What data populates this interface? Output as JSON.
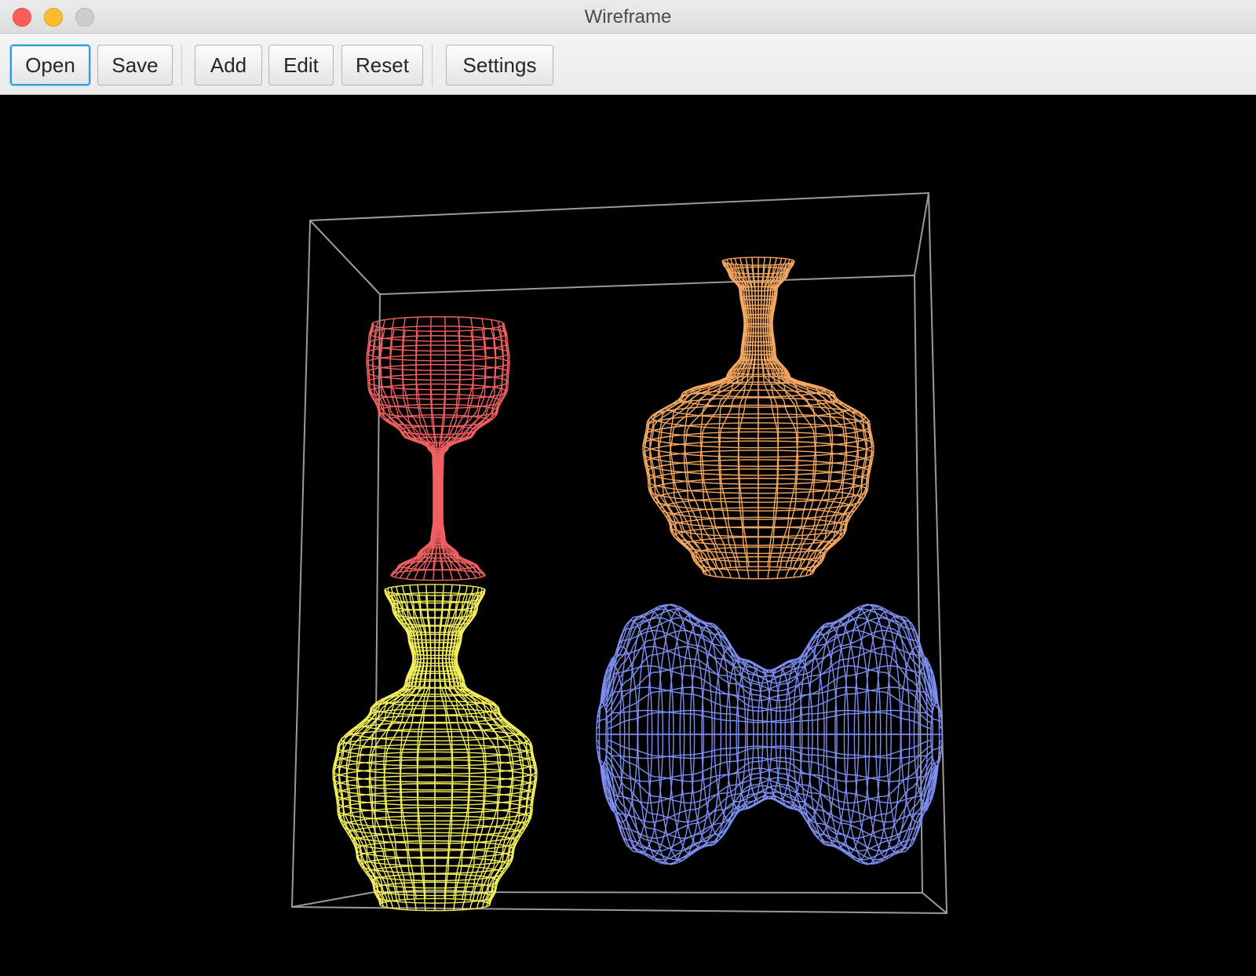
{
  "window": {
    "title": "Wireframe"
  },
  "toolbar": {
    "buttons": [
      {
        "label": "Open",
        "focused": true
      },
      {
        "label": "Save"
      },
      {
        "label": "Add"
      },
      {
        "label": "Edit"
      },
      {
        "label": "Reset"
      },
      {
        "label": "Settings"
      }
    ]
  },
  "scene": {
    "background": "#000000",
    "bounding_box_color": "#9a9a9a",
    "objects": [
      {
        "name": "wine-glass",
        "color": "#f06060"
      },
      {
        "name": "orange-vase",
        "color": "#f5a861"
      },
      {
        "name": "yellow-vase",
        "color": "#f5ef5c"
      },
      {
        "name": "blue-hourglass",
        "color": "#7c8ff0"
      }
    ]
  }
}
